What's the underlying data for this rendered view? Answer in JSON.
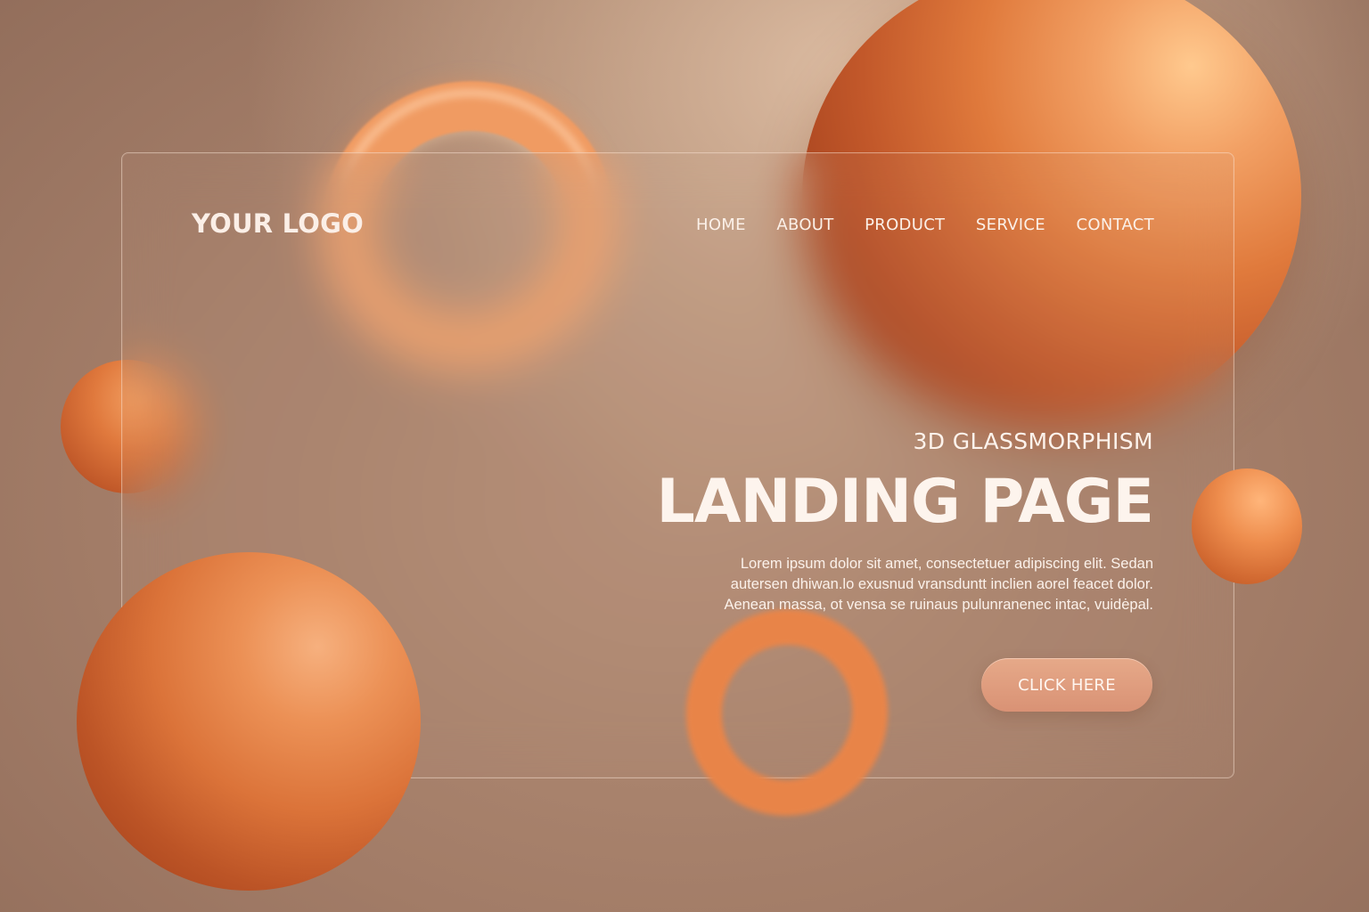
{
  "brand": {
    "logo_text": "YOUR LOGO"
  },
  "nav": {
    "items": [
      {
        "label": "HOME"
      },
      {
        "label": "ABOUT"
      },
      {
        "label": "PRODUCT"
      },
      {
        "label": "SERVICE"
      },
      {
        "label": "CONTACT"
      }
    ]
  },
  "hero": {
    "subtitle": "3D GLASSMORPHISM",
    "title": "LANDING PAGE",
    "body_lines": [
      "Lorem ipsum dolor sit amet, consectetuer adipiscing elit. Sedan",
      "autersen dhiwan.lo exusnud vransduntt inclien aorel feacet dolor.",
      "Aenean massa, ot vensa se ruinaus pulunranenec intac, vuidėpal."
    ],
    "cta_label": "CLICK HERE"
  },
  "colors": {
    "accent": "#e07a3c",
    "background": "#a27c67",
    "text": "#fbf0e8"
  }
}
